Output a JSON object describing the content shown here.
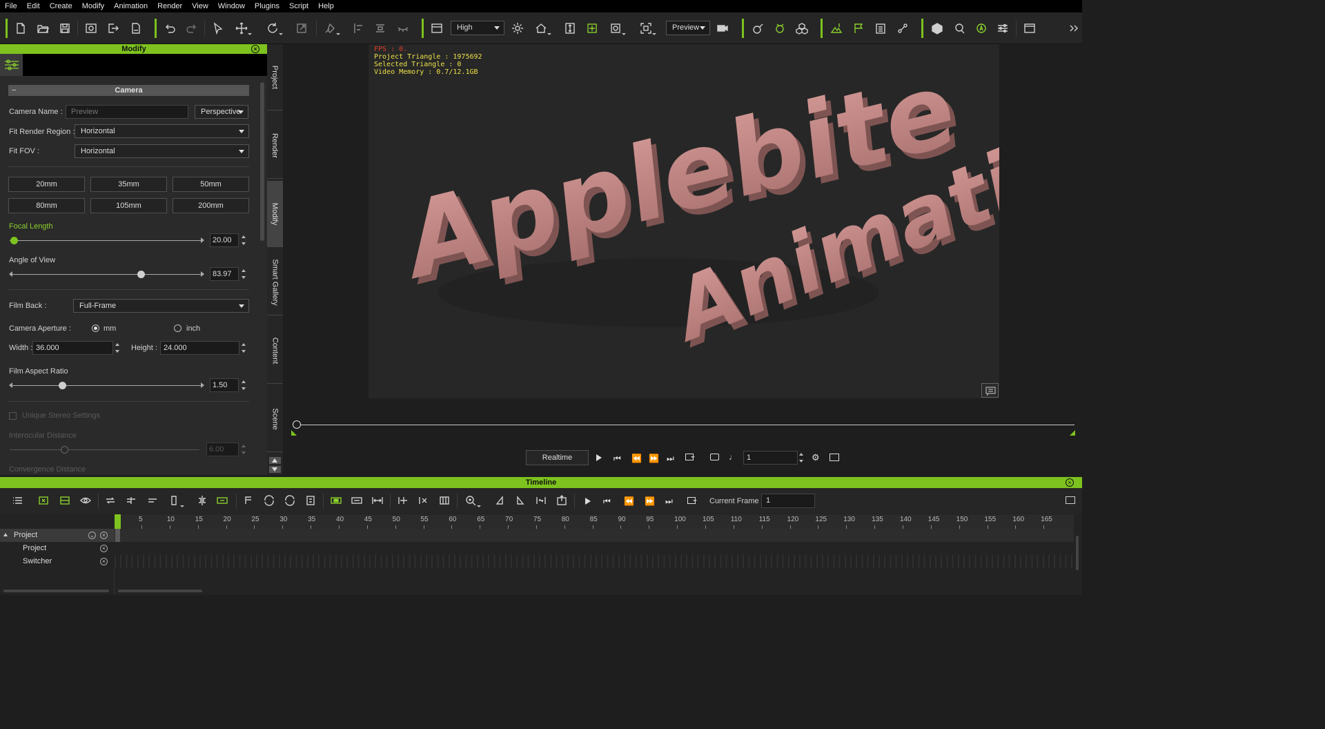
{
  "menu": [
    "File",
    "Edit",
    "Create",
    "Modify",
    "Animation",
    "Render",
    "View",
    "Window",
    "Plugins",
    "Script",
    "Help"
  ],
  "toolbar": {
    "quality": "High",
    "camera": "Preview"
  },
  "modify_panel": {
    "title": "Modify",
    "section": "Camera",
    "camera_name_label": "Camera Name :",
    "camera_name_placeholder": "Preview",
    "projection": "Perspective",
    "fit_render_region_label": "Fit Render Region :",
    "fit_render_region": "Horizontal",
    "fit_fov_label": "Fit FOV :",
    "fit_fov": "Horizontal",
    "lens_presets": [
      "20mm",
      "35mm",
      "50mm",
      "80mm",
      "105mm",
      "200mm"
    ],
    "focal_length_label": "Focal Length",
    "focal_length": "20.00",
    "angle_of_view_label": "Angle of View",
    "angle_of_view": "83.97",
    "film_back_label": "Film Back :",
    "film_back": "Full-Frame",
    "camera_aperture_label": "Camera Aperture :",
    "aperture_mm": "mm",
    "aperture_inch": "inch",
    "width_label": "Width :",
    "width": "36.000",
    "height_label": "Height :",
    "height": "24.000",
    "film_aspect_label": "Film Aspect Ratio",
    "film_aspect": "1.50",
    "unique_stereo_label": "Unique Stereo Settings",
    "interocular_label": "Interocular Distance",
    "interocular": "6.00",
    "convergence_label": "Convergence Distance",
    "focal_length_level": 0.0,
    "angle_of_view_level": 0.68,
    "film_aspect_level": 0.26,
    "interocular_level": 0.27
  },
  "side_tabs": [
    "Project",
    "Render",
    "Modify",
    "Smart Gallery",
    "Content",
    "Scene"
  ],
  "viewport": {
    "fps": "FPS : 0.",
    "project_triangle": "Project Triangle : 1975692",
    "selected_triangle": "Selected Triangle : 0",
    "video_memory": "Video Memory : 0.7/12.1GB",
    "scene_line1": "Applebite",
    "scene_line2": "Animation",
    "text_color": "#c68a88"
  },
  "playback": {
    "realtime": "Realtime",
    "frame": "1"
  },
  "timeline": {
    "title": "Timeline",
    "current_frame_label": "Current Frame :",
    "current_frame": "1",
    "ticks": [
      "5",
      "10",
      "15",
      "20",
      "25",
      "30",
      "35",
      "40",
      "45",
      "50",
      "55",
      "60",
      "65",
      "70",
      "75",
      "80",
      "85",
      "90",
      "95",
      "100",
      "105",
      "110",
      "115",
      "120",
      "125",
      "130",
      "135",
      "140",
      "145",
      "150",
      "155",
      "160",
      "165"
    ],
    "tracks": [
      "Project",
      "Project",
      "Switcher"
    ]
  },
  "colors": {
    "accent": "#7dc21e"
  }
}
